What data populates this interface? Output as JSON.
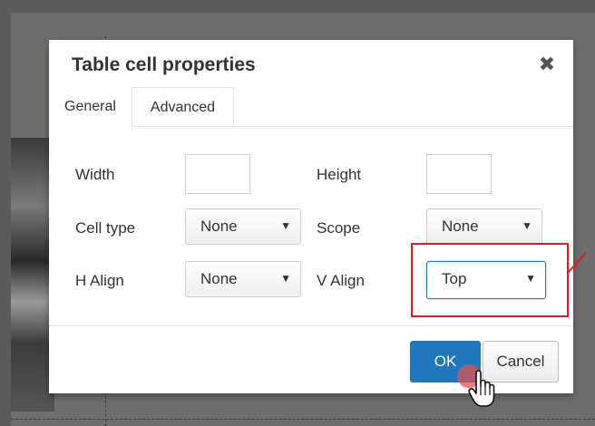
{
  "dialog": {
    "title": "Table cell properties",
    "close_icon": "close-icon"
  },
  "tabs": [
    {
      "label": "General",
      "active": true
    },
    {
      "label": "Advanced",
      "active": false
    }
  ],
  "fields": {
    "width": {
      "label": "Width",
      "value": ""
    },
    "height": {
      "label": "Height",
      "value": ""
    },
    "cell_type": {
      "label": "Cell type",
      "value": "None"
    },
    "scope": {
      "label": "Scope",
      "value": "None"
    },
    "h_align": {
      "label": "H Align",
      "value": "None"
    },
    "v_align": {
      "label": "V Align",
      "value": "Top"
    }
  },
  "buttons": {
    "ok": "OK",
    "cancel": "Cancel"
  },
  "colors": {
    "ok_button": "#2077bd",
    "highlight": "#e01c1c",
    "focus_border": "#2376b7"
  }
}
